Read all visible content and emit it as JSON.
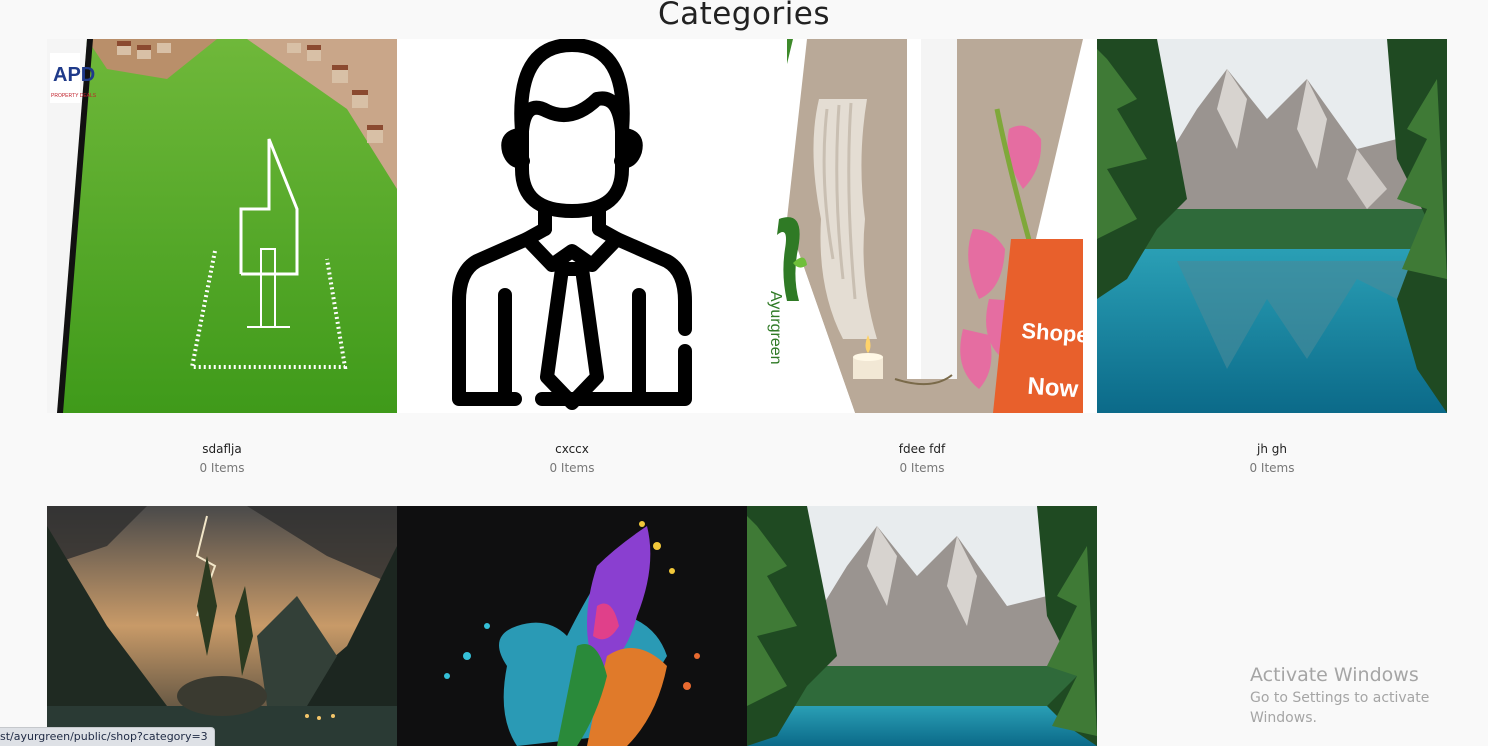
{
  "page": {
    "title": "Categories"
  },
  "categories": [
    {
      "name": "sdaflja",
      "count": "0 Items",
      "image": "land-plot-with-house-outline"
    },
    {
      "name": "cxccx",
      "count": "0 Items",
      "image": "businessman-outline-icon"
    },
    {
      "name": "fdee fdf",
      "count": "0 Items",
      "image": "ayurgreen-towel-banner"
    },
    {
      "name": "jh gh",
      "count": "0 Items",
      "image": "mountain-lake-landscape"
    },
    {
      "name": "",
      "count": "",
      "image": "stormy-mountain-landscape"
    },
    {
      "name": "",
      "count": "",
      "image": "colorful-paint-splash"
    },
    {
      "name": "",
      "count": "",
      "image": "mountain-lake-landscape"
    }
  ],
  "image_text": {
    "logo_letters": "APD",
    "logo_sub": "PROPERTY DEALS",
    "banner_brand": "Ayurgreen",
    "banner_cta_1": "Shope",
    "banner_cta_2": "Now"
  },
  "overlay": {
    "activate_title": "Activate Windows",
    "activate_sub": "Go to Settings to activate Windows."
  },
  "status_bar": {
    "url": "st/ayurgreen/public/shop?category=3"
  }
}
